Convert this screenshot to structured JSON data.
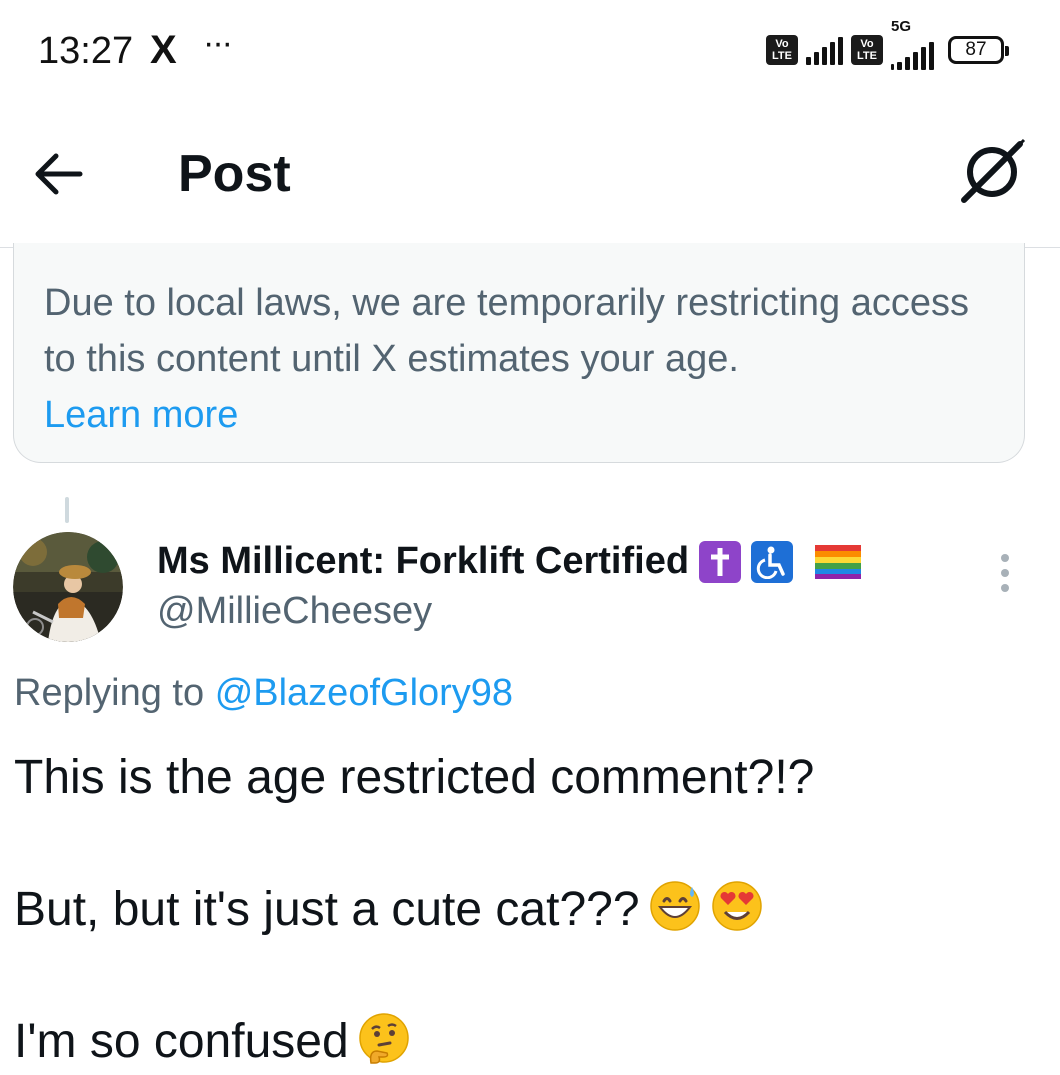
{
  "status_bar": {
    "time": "13:27",
    "app_icon": "X",
    "overflow": "···",
    "volte_1": "Vo LTE",
    "volte_2": "Vo LTE",
    "network": "5G",
    "battery": "87"
  },
  "header": {
    "title": "Post",
    "back_icon": "arrow-left-icon",
    "grok_icon": "grok-icon"
  },
  "notice": {
    "text": "Due to local laws, we are temporarily restricting access to this content until X estimates your age.",
    "link": "Learn more"
  },
  "post": {
    "display_name": "Ms Millicent: Forklift Certified",
    "badges": [
      "latin-cross-emoji",
      "wheelchair-symbol-emoji",
      "rainbow-flag-emoji"
    ],
    "handle": "@MillieCheesey",
    "replying_prefix": "Replying to",
    "replying_to": "@BlazeofGlory98",
    "lines": [
      "This is the age restricted comment?!?",
      "But, but it's just a cute cat???",
      "I'm so confused"
    ],
    "line2_emojis": [
      "grinning-face-with-sweat-emoji",
      "smiling-face-with-heart-eyes-emoji"
    ],
    "line3_emoji": "thinking-face-emoji"
  },
  "colors": {
    "link": "#1d9bf0",
    "secondary_text": "#536471",
    "primary_text": "#0f1419",
    "notice_bg": "#f7f9f9"
  }
}
